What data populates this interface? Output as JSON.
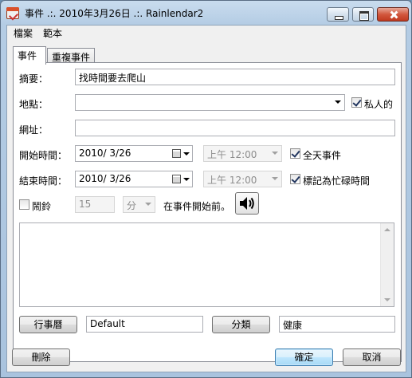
{
  "window": {
    "title": "事件 .:. 2010年3月26日 .:. Rainlendar2"
  },
  "menu": {
    "items": [
      "檔案",
      "範本"
    ]
  },
  "tabs": [
    {
      "label": "事件",
      "active": true
    },
    {
      "label": "重複事件",
      "active": false
    }
  ],
  "form": {
    "summary_label": "摘要：",
    "summary_value": "找時間要去爬山",
    "location_label": "地點：",
    "location_value": "",
    "private_label": "私人的",
    "private_checked": true,
    "url_label": "網址：",
    "url_value": "",
    "start_label": "開始時間：",
    "start_date": "2010/  3/26",
    "start_time": "上午 12:00",
    "allday_label": "全天事件",
    "allday_checked": true,
    "end_label": "結束時間：",
    "end_date": "2010/  3/26",
    "end_time": "上午 12:00",
    "busy_label": "標記為忙碌時間",
    "busy_checked": true,
    "alarm_label": "鬧鈴",
    "alarm_checked": false,
    "alarm_amount": "15",
    "alarm_unit": "分",
    "alarm_suffix": "在事件開始前。",
    "sound_icon": "speaker-icon",
    "description": ""
  },
  "bottom": {
    "calendar_button": "行事曆",
    "calendar_value": "Default",
    "category_button": "分類",
    "category_value": "健康"
  },
  "actions": {
    "delete": "刪除",
    "ok": "確定",
    "cancel": "取消"
  }
}
